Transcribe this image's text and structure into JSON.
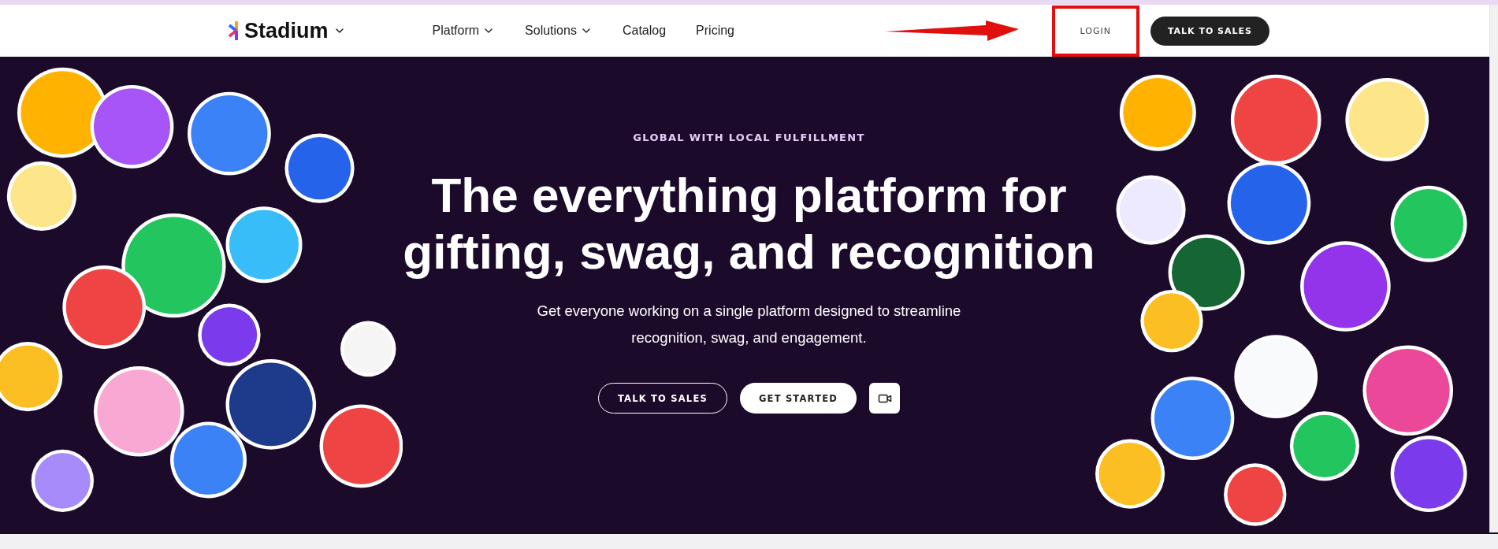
{
  "header": {
    "logo": "Stadium",
    "nav": [
      {
        "label": "Platform",
        "has_dropdown": true
      },
      {
        "label": "Solutions",
        "has_dropdown": true
      },
      {
        "label": "Catalog",
        "has_dropdown": false
      },
      {
        "label": "Pricing",
        "has_dropdown": false
      }
    ],
    "actions": [
      {
        "label": "LOGIN",
        "kind": "plain"
      },
      {
        "label": "TALK TO SALES",
        "kind": "dark"
      }
    ]
  },
  "hero": {
    "eyebrow": "GLOBAL WITH LOCAL FULFILLMENT",
    "headline": [
      "The everything platform for",
      "gifting, swag, and recognition"
    ],
    "subtitle": [
      "Get everyone working on a single platform designed to streamline",
      "recognition, swag, and engagement."
    ],
    "buttons": [
      {
        "label": "TALK TO SALES",
        "kind": "outline"
      },
      {
        "label": "GET STARTED",
        "kind": "solid"
      },
      {
        "kind": "video"
      }
    ]
  }
}
